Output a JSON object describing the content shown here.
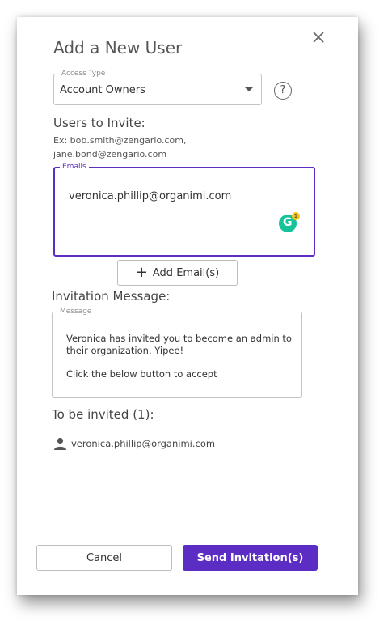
{
  "dialog": {
    "title": "Add a New User",
    "close_icon": "close-icon"
  },
  "access_type": {
    "label": "Access Type",
    "value": "Account Owners",
    "help_glyph": "?"
  },
  "users_to_invite": {
    "heading": "Users to Invite:",
    "hint_line1": "Ex: bob.smith@zengario.com,",
    "hint_line2": "jane.bond@zengario.com"
  },
  "emails_field": {
    "label": "Emails",
    "value": "veronica.phillip@organimi.com",
    "grammarly_glyph": "G",
    "grammarly_count": "1"
  },
  "add_email_button": {
    "icon": "+",
    "label": "Add Email(s)"
  },
  "invitation": {
    "heading": "Invitation Message:",
    "field_label": "Message",
    "body": "Veronica has invited you to become an admin to their organization. Yipee!\n\nClick the below button to accept"
  },
  "to_be_invited": {
    "heading": "To be invited (1):",
    "items": [
      "veronica.phillip@organimi.com"
    ]
  },
  "footer": {
    "cancel_label": "Cancel",
    "send_label": "Send Invitation(s)"
  },
  "colors": {
    "accent": "#5b2dc4",
    "grammarly": "#15c39a",
    "badge": "#f3c31f"
  }
}
